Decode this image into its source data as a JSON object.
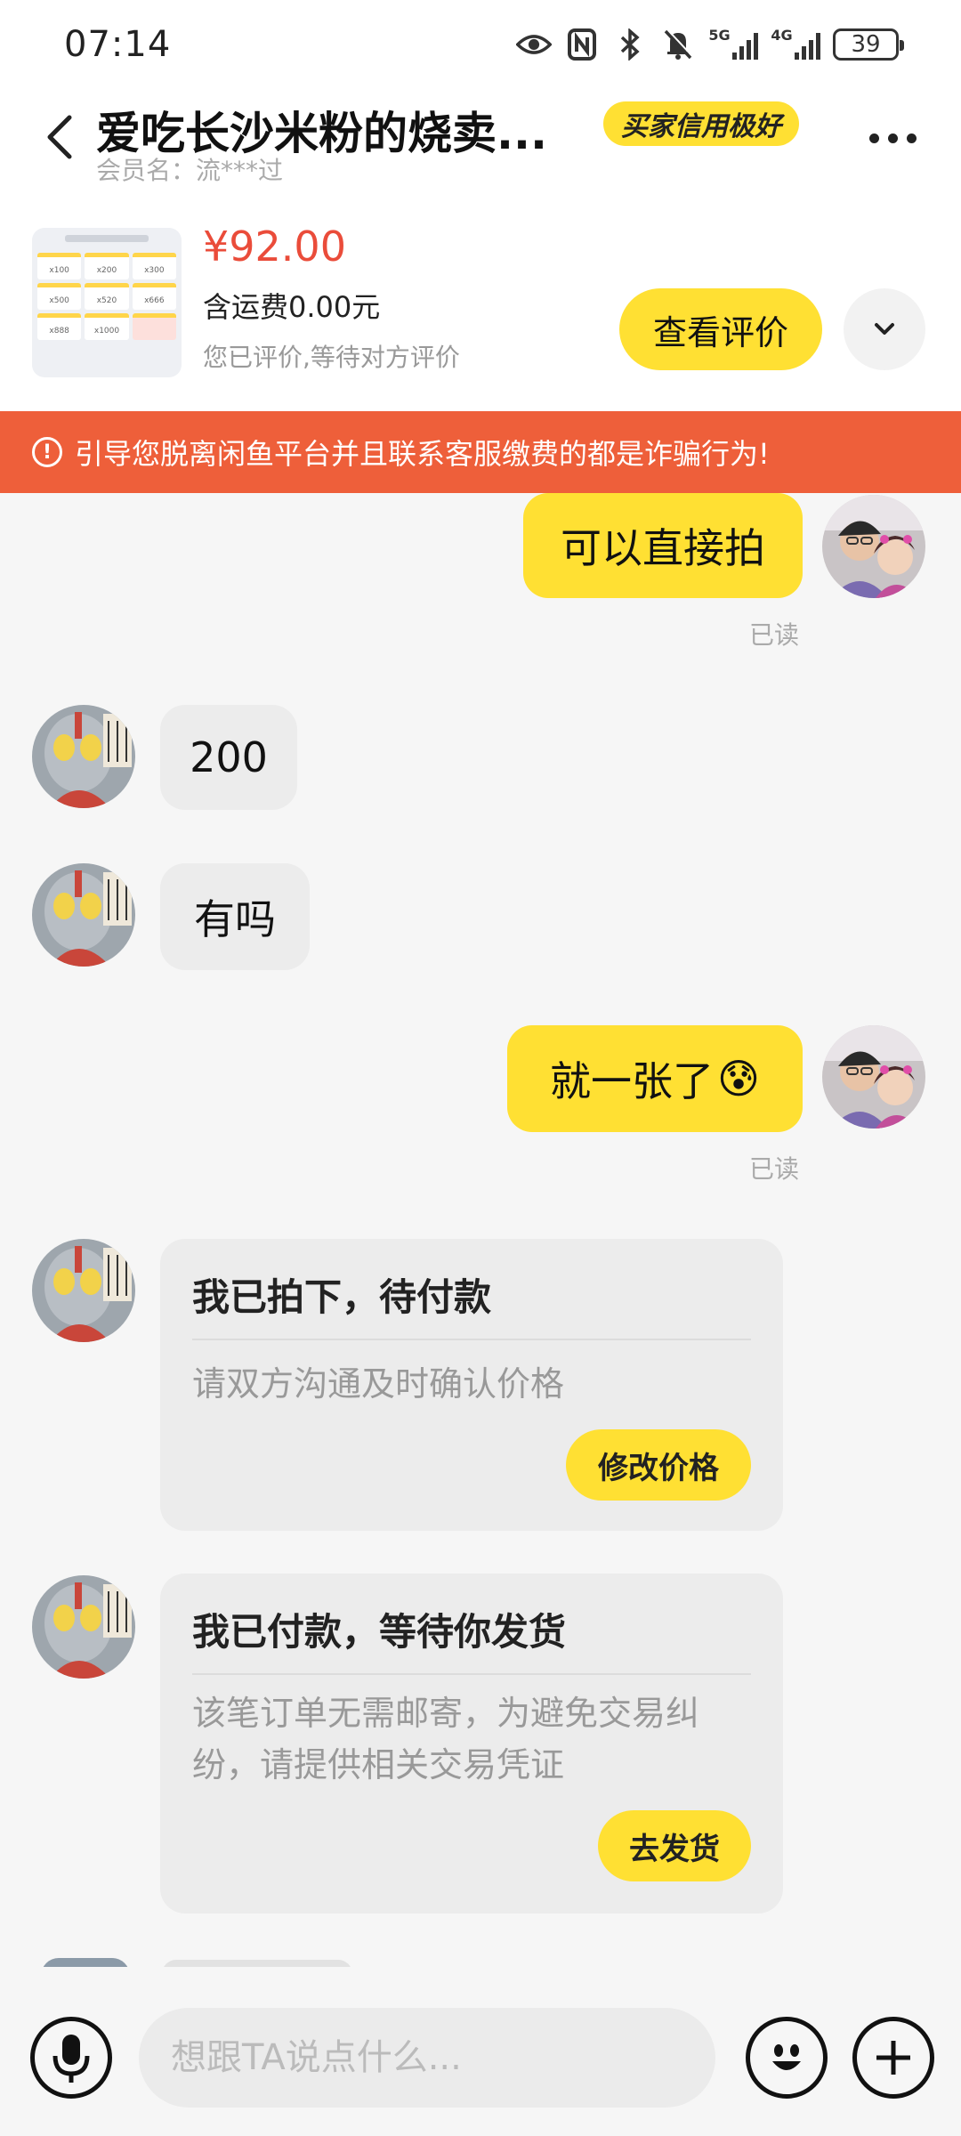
{
  "status_bar": {
    "time": "07:14",
    "net1": "5G",
    "net2": "4G",
    "battery": "39",
    "icons": [
      "eye-icon",
      "nfc-icon",
      "bluetooth-icon",
      "bell-muted-icon",
      "signal-5g-icon",
      "signal-4g-icon",
      "battery-icon"
    ]
  },
  "header": {
    "title": "爱吃长沙米粉的烧卖...",
    "member_label": "会员名：流***过",
    "credit_badge": "买家信用极好"
  },
  "product": {
    "price": "¥92.00",
    "shipping": "含运费0.00元",
    "review_status": "您已评价,等待对方评价",
    "view_review_label": "查看评价",
    "thumb_cells": [
      "x100",
      "x200",
      "x300",
      "x500",
      "x520",
      "x666",
      "x888",
      "x1000",
      ""
    ]
  },
  "warning": {
    "text": "引导您脱离闲鱼平台并且联系客服缴费的都是诈骗行为!"
  },
  "messages": {
    "m1": {
      "text": "可以直接拍",
      "read": "已读"
    },
    "m2": {
      "text": "200"
    },
    "m3": {
      "text": "有吗"
    },
    "m4": {
      "text": "就一张了",
      "emoji": "😰",
      "read": "已读"
    },
    "card1": {
      "title": "我已拍下，待付款",
      "body": "请双方沟通及时确认价格",
      "button": "修改价格"
    },
    "card2": {
      "title": "我已付款，等待你发货",
      "body": "该笔订单无需邮寄，为避免交易纠纷，请提供相关交易凭证",
      "button": "去发货"
    }
  },
  "input": {
    "placeholder": "想跟TA说点什么..."
  },
  "colors": {
    "accent_yellow": "#ffe033",
    "price_red": "#ea4c3a",
    "warning_orange": "#ee5f3a",
    "peer_bubble": "#ececec"
  }
}
